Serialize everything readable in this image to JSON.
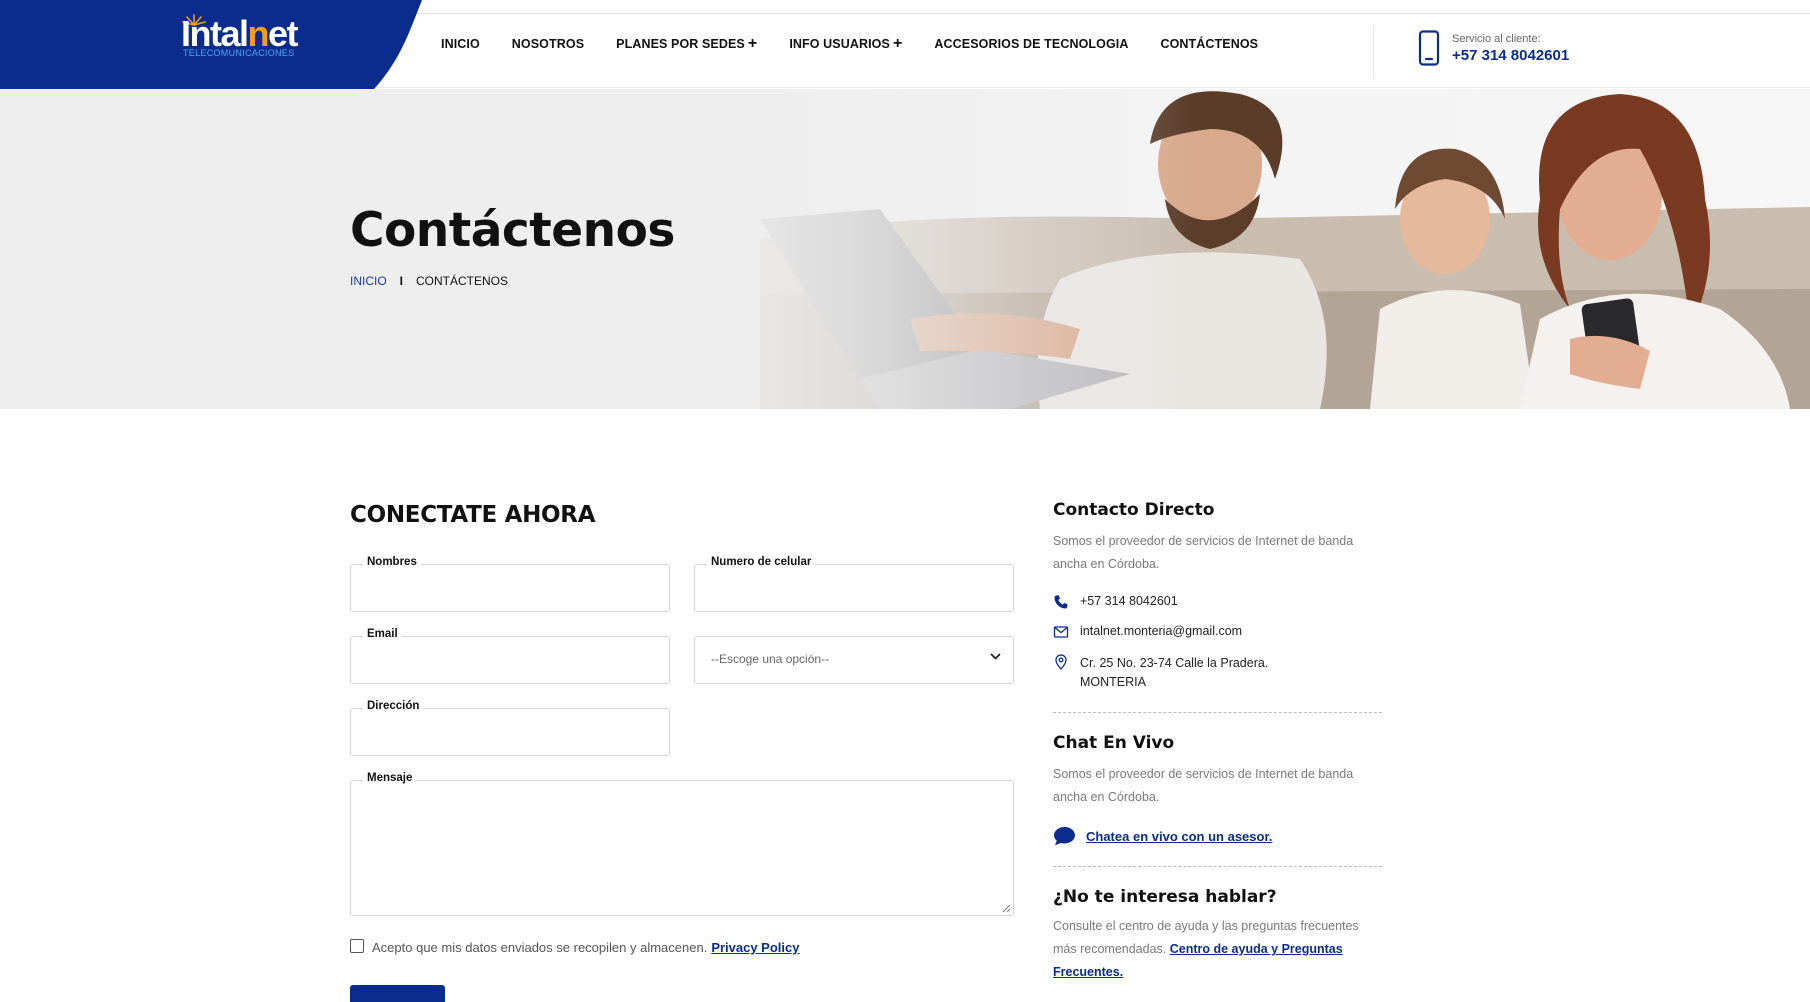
{
  "brand": {
    "logo_main_a": "Intal",
    "logo_main_b": "n",
    "logo_main_c": "et",
    "logo_sub": "TELECOMUNICACIONES",
    "primary_color": "#0a2c8c",
    "accent_color": "#f39c1f"
  },
  "nav": {
    "items": [
      {
        "label": "INICIO",
        "has_submenu": false
      },
      {
        "label": "NOSOTROS",
        "has_submenu": false
      },
      {
        "label": "PLANES POR SEDES",
        "has_submenu": true
      },
      {
        "label": "INFO USUARIOS",
        "has_submenu": true
      },
      {
        "label": "ACCESORIOS DE TECNOLOGIA",
        "has_submenu": false
      },
      {
        "label": "CONTÁCTENOS",
        "has_submenu": false
      }
    ],
    "submenu_glyph": "+"
  },
  "service": {
    "icon": "mobile-phone-icon",
    "label": "Servicio al cliente:",
    "phone": "+57 314 8042601"
  },
  "hero": {
    "title": "Contáctenos",
    "breadcrumb": {
      "home": "INICIO",
      "separator": "I",
      "current": "CONTÁCTENOS"
    }
  },
  "form": {
    "title": "CONECTATE AHORA",
    "fields": {
      "nombres": {
        "label": "Nombres",
        "value": ""
      },
      "celular": {
        "label": "Numero de celular",
        "value": ""
      },
      "email": {
        "label": "Email",
        "value": ""
      },
      "opcion": {
        "selected": "--Escoge una opción--"
      },
      "direccion": {
        "label": "Dirección",
        "value": ""
      },
      "mensaje": {
        "label": "Mensaje",
        "value": ""
      }
    },
    "consent_text": "Acepto que mis datos enviados se recopilen y almacenen.",
    "consent_link": "Privacy Policy",
    "consent_checked": false
  },
  "sidebar": {
    "direct": {
      "title": "Contacto Directo",
      "desc": "Somos el proveedor de servicios de Internet de banda ancha en Córdoba.",
      "phone": "+57 314 8042601",
      "email": "intalnet.monteria@gmail.com",
      "address_line1": "Cr. 25 No. 23-74 Calle la Pradera.",
      "address_line2": "MONTERIA"
    },
    "chat": {
      "title": "Chat En Vivo",
      "desc": "Somos el proveedor de servicios de Internet de banda ancha en Córdoba.",
      "link": "Chatea en vivo con un asesor."
    },
    "help": {
      "title": "¿No te interesa hablar?",
      "desc": "Consulte el centro de ayuda y las preguntas frecuentes más recomendadas.",
      "link": "Centro de ayuda y Preguntas Frecuentes."
    }
  }
}
